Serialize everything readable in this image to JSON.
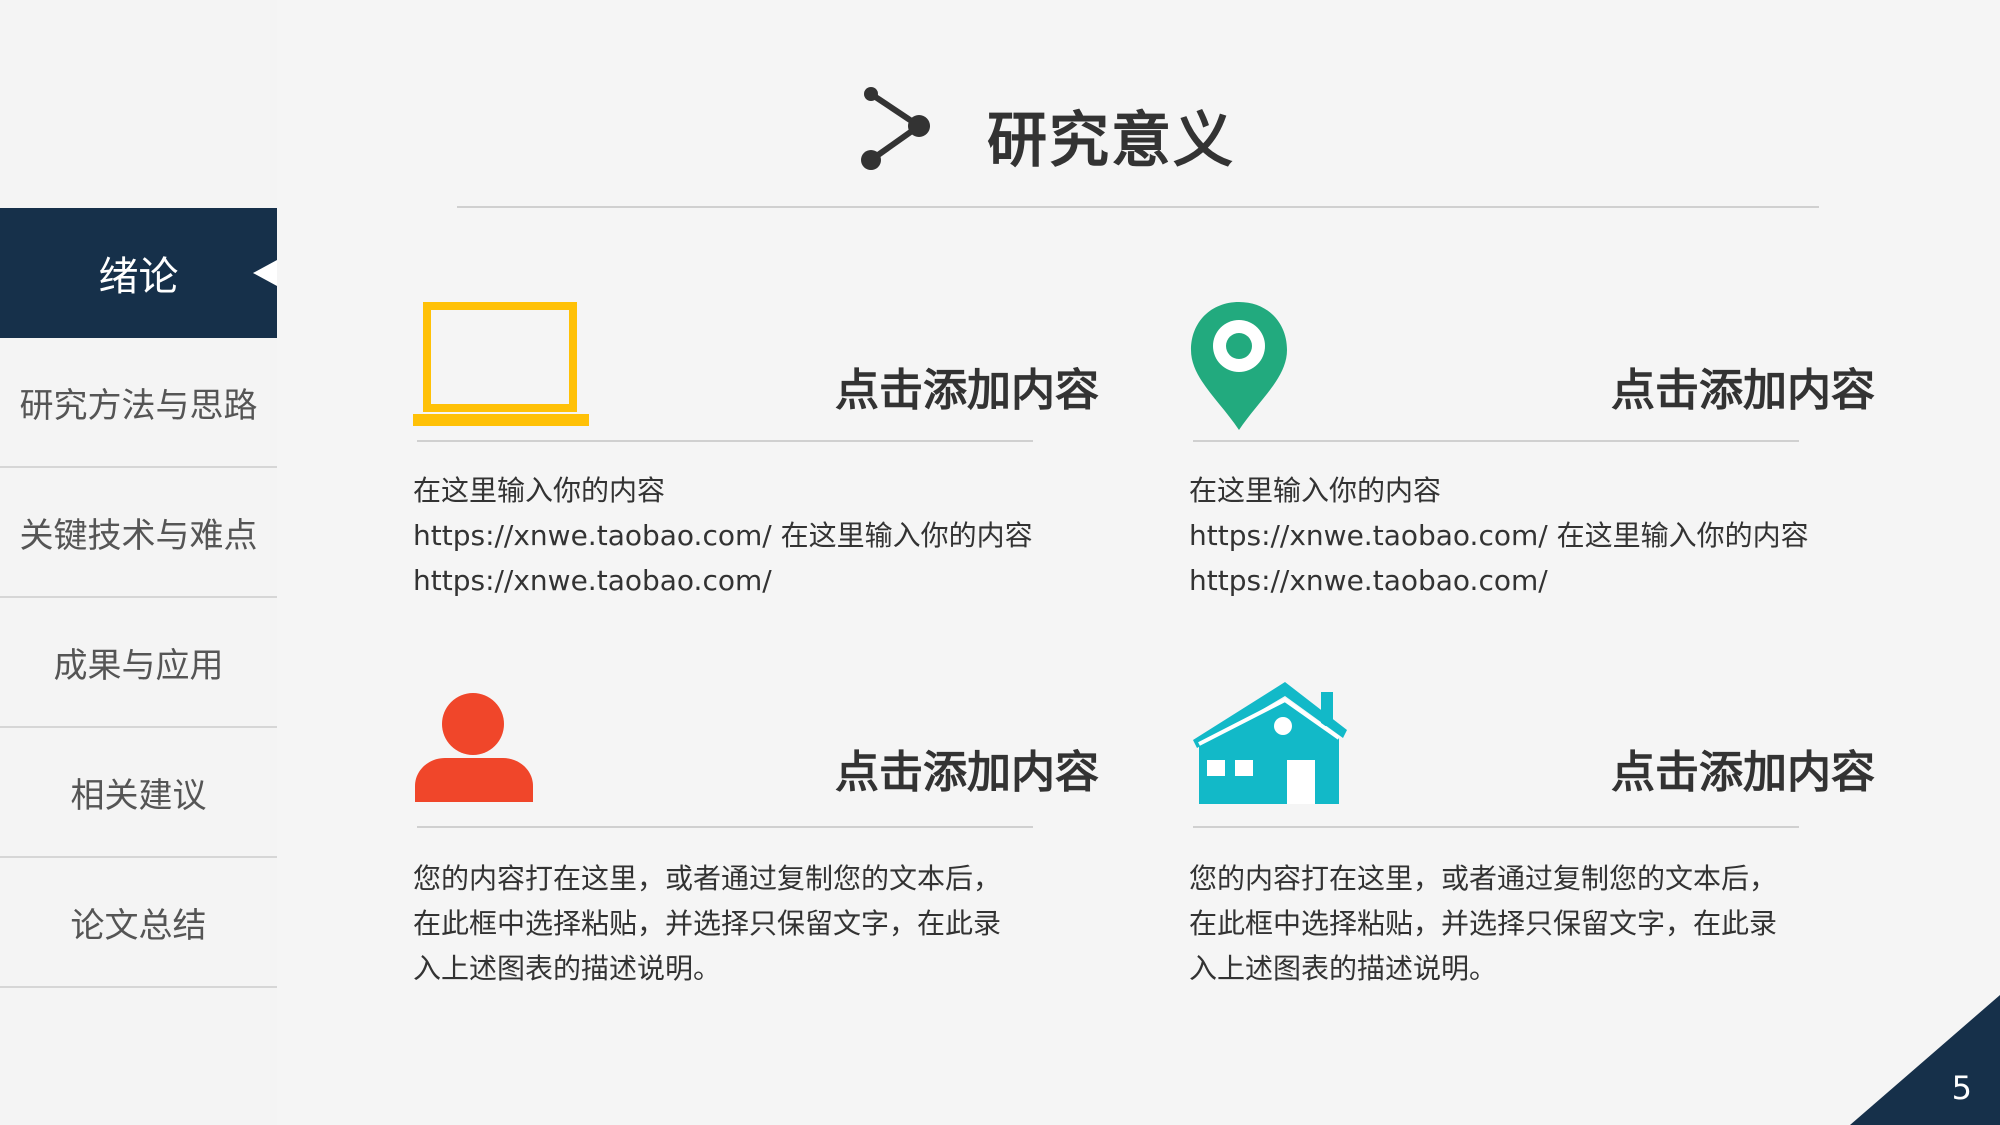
{
  "sidebar": {
    "items": [
      {
        "label": "绪论",
        "active": true
      },
      {
        "label": "研究方法与思路"
      },
      {
        "label": "关键技术与难点"
      },
      {
        "label": "成果与应用"
      },
      {
        "label": "相关建议"
      },
      {
        "label": "论文总结"
      }
    ]
  },
  "header": {
    "title": "研究意义",
    "icon": "share-icon"
  },
  "cards": [
    {
      "icon": "laptop-icon",
      "color": "#ffc107",
      "heading": "点击添加内容",
      "lines": [
        "在这里输入你的内容",
        "https://xnwe.taobao.com/ 在这里输入你的内容",
        "https://xnwe.taobao.com/"
      ]
    },
    {
      "icon": "location-pin-icon",
      "color": "#22aa7e",
      "heading": "点击添加内容",
      "lines": [
        "在这里输入你的内容",
        "https://xnwe.taobao.com/ 在这里输入你的内容",
        "https://xnwe.taobao.com/"
      ]
    },
    {
      "icon": "user-icon",
      "color": "#f0462a",
      "heading": "点击添加内容",
      "lines": [
        "您的内容打在这里，或者通过复制您的文本后，",
        "在此框中选择粘贴，并选择只保留文字，在此录",
        "入上述图表的描述说明。"
      ]
    },
    {
      "icon": "house-icon",
      "color": "#12b9c8",
      "heading": "点击添加内容",
      "lines": [
        "您的内容打在这里，或者通过复制您的文本后，",
        "在此框中选择粘贴，并选择只保留文字，在此录",
        "入上述图表的描述说明。"
      ]
    }
  ],
  "footer": {
    "page_number": "5",
    "accent": "#16304a"
  }
}
